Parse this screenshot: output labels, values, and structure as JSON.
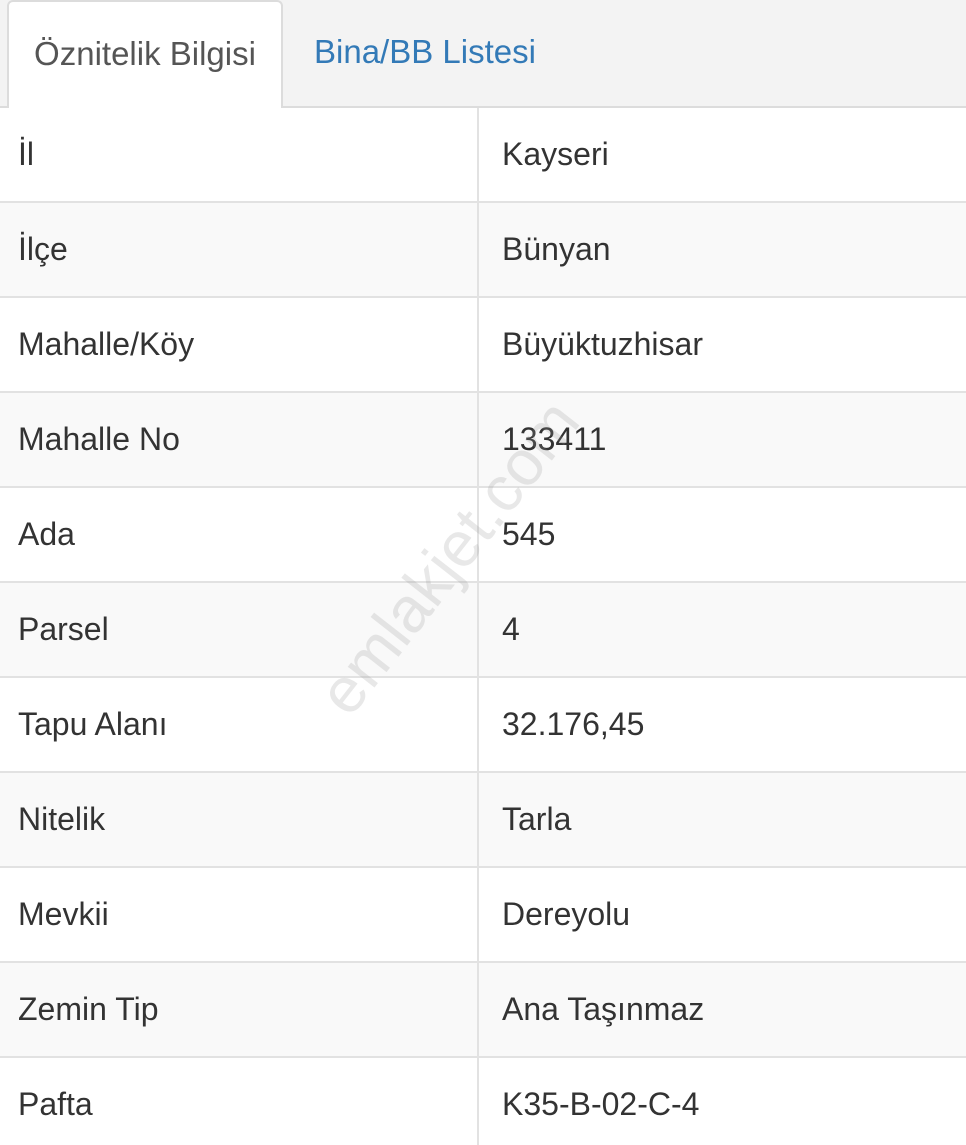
{
  "tabs": [
    {
      "label": "Öznitelik Bilgisi",
      "active": true
    },
    {
      "label": "Bina/BB Listesi",
      "active": false
    }
  ],
  "rows": [
    {
      "label": "İl",
      "value": "Kayseri"
    },
    {
      "label": "İlçe",
      "value": "Bünyan"
    },
    {
      "label": "Mahalle/Köy",
      "value": "Büyüktuzhisar"
    },
    {
      "label": "Mahalle No",
      "value": "133411"
    },
    {
      "label": "Ada",
      "value": "545"
    },
    {
      "label": "Parsel",
      "value": "4"
    },
    {
      "label": "Tapu Alanı",
      "value": "32.176,45"
    },
    {
      "label": "Nitelik",
      "value": "Tarla"
    },
    {
      "label": "Mevkii",
      "value": "Dereyolu"
    },
    {
      "label": "Zemin Tip",
      "value": "Ana Taşınmaz"
    },
    {
      "label": "Pafta",
      "value": "K35-B-02-C-4"
    }
  ],
  "watermark": "emlakjet.com",
  "colors": {
    "tab_link": "#337ab7",
    "text": "#333333",
    "row_alt": "#f9f9f9",
    "border": "#e2e2e2"
  }
}
